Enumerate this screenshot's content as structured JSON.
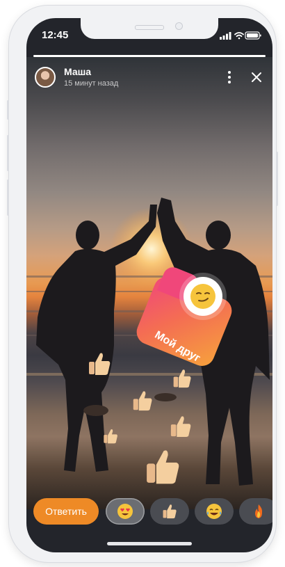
{
  "status_bar": {
    "time": "12:45",
    "icons": [
      "signal-icon",
      "wifi-icon",
      "battery-icon"
    ]
  },
  "story": {
    "progress": 1.0,
    "author_name": "Маша",
    "posted_ago": "15 минут назад",
    "actions": [
      "more-icon",
      "close-icon"
    ]
  },
  "sticker": {
    "label": "Мой друг",
    "emoji": "smirking-face-emoji",
    "colors": {
      "from": "#f0477a",
      "to": "#f6a23c"
    }
  },
  "reply": {
    "button_label": "Ответить",
    "reactions": [
      {
        "name": "heart-eyes-emoji",
        "selected": true
      },
      {
        "name": "thumbs-up-emoji",
        "selected": false
      },
      {
        "name": "tears-of-joy-emoji",
        "selected": false
      },
      {
        "name": "fire-emoji",
        "selected": false
      }
    ],
    "accent_color": "#ee8a26"
  }
}
